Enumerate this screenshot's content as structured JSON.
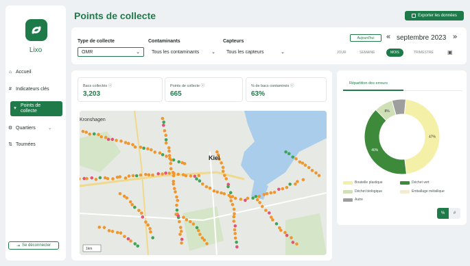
{
  "app": {
    "name": "Lixo",
    "brand_color": "#1f7a4a"
  },
  "sidebar": {
    "items": [
      {
        "label": "Accueil",
        "icon": "home-icon"
      },
      {
        "label": "Indicateurs clés",
        "icon": "hash-icon"
      },
      {
        "label": "Points de collecte",
        "icon": "pin-icon",
        "active": true
      },
      {
        "label": "Quartiers",
        "icon": "gear-icon"
      },
      {
        "label": "Tournées",
        "icon": "route-icon"
      }
    ],
    "logout_label": "Se déconnecter"
  },
  "header": {
    "title": "Points de collecte",
    "export_label": "Exporter les données"
  },
  "filters": {
    "type_label": "Type de collecte",
    "type_value": "OMR",
    "contaminants_label": "Contaminants",
    "contaminants_value": "Tous les contaminants",
    "sensors_label": "Capteurs",
    "sensors_value": "Tous les capteurs",
    "today_label": "Aujourd'hui",
    "month_label": "septembre 2023",
    "prev": "«",
    "next": "»",
    "periods": [
      "JOUR",
      "SEMAINE",
      "MOIS",
      "TRIMESTRE"
    ],
    "active_period": "MOIS"
  },
  "kpis": [
    {
      "label": "Bacs collectés",
      "value": "3,203"
    },
    {
      "label": "Points de collecte",
      "value": "665"
    },
    {
      "label": "% de bacs contaminés",
      "value": "63%"
    }
  ],
  "map": {
    "labels": {
      "city": "Kiel",
      "district": "Kronshagen",
      "scale": "1km"
    }
  },
  "errors_panel": {
    "tab_label": "Répartition des erreurs",
    "chart_data": {
      "type": "pie",
      "slices": [
        {
          "label": "Bouteille plastique",
          "value": 47,
          "color": "#f5f0a8"
        },
        {
          "label": "Déchet vert",
          "value": 40,
          "color": "#3d8a3a"
        },
        {
          "label": "Déchet biologique",
          "value": 8,
          "color": "#cfe0b6"
        },
        {
          "label": "Emballage métallique",
          "value": 0,
          "color": "#f3ecd2"
        },
        {
          "label": "Autre",
          "value": 6,
          "color": "#9e9e9e"
        }
      ],
      "slice_labels": [
        "47%",
        "40%",
        "8%",
        "6%"
      ]
    },
    "toggle": {
      "percent": "%",
      "count": "#"
    }
  }
}
